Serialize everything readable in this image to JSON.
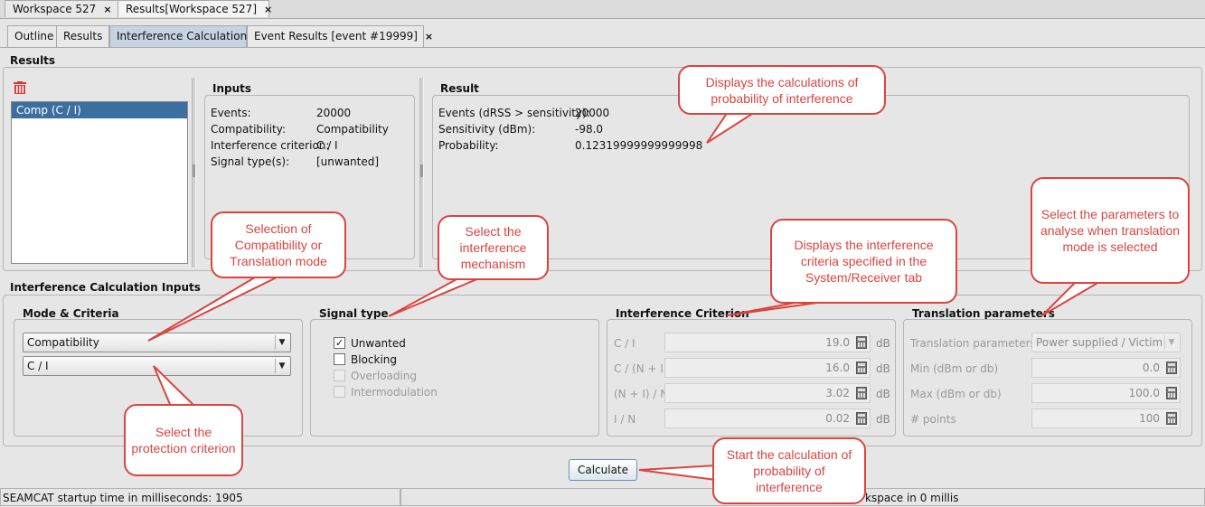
{
  "tabs_top": [
    {
      "label": "Workspace 527",
      "close": "×"
    },
    {
      "label": "Results[Workspace 527]",
      "close": "×"
    }
  ],
  "tabs_sub": [
    {
      "label": "Outline"
    },
    {
      "label": "Results"
    },
    {
      "label": "Interference Calculations"
    },
    {
      "label": "Event Results [event #19999]",
      "close": "×"
    }
  ],
  "results": {
    "section_title": "Results",
    "list_items": [
      "Comp (C / I)"
    ],
    "inputs": {
      "title": "Inputs",
      "rows": [
        {
          "label": "Events:",
          "value": "20000"
        },
        {
          "label": "Compatibility:",
          "value": "Compatibility"
        },
        {
          "label": "Interference criterion:",
          "value": "C / I"
        },
        {
          "label": "Signal type(s):",
          "value": "[unwanted]"
        }
      ]
    },
    "result": {
      "title": "Result",
      "rows": [
        {
          "label": "Events (dRSS > sensitivity):",
          "value": "20000"
        },
        {
          "label": "Sensitivity (dBm):",
          "value": "-98.0"
        },
        {
          "label": "Probability:",
          "value": "0.12319999999999998"
        }
      ]
    }
  },
  "calc_inputs": {
    "section_title": "Interference Calculation Inputs",
    "mode": {
      "title": "Mode & Criteria",
      "mode_value": "Compatibility",
      "criterion_value": "C / I",
      "arrow": "▼"
    },
    "signal": {
      "title": "Signal type",
      "items": [
        {
          "label": "Unwanted",
          "checked": true,
          "enabled": true,
          "mark": "✓"
        },
        {
          "label": "Blocking",
          "checked": false,
          "enabled": true
        },
        {
          "label": "Overloading",
          "checked": false,
          "enabled": false
        },
        {
          "label": "Intermodulation",
          "checked": false,
          "enabled": false
        }
      ]
    },
    "criterion": {
      "title": "Interference Criterion",
      "rows": [
        {
          "label": "C / I",
          "value": "19.0",
          "unit": "dB"
        },
        {
          "label": "C / (N + I)",
          "value": "16.0",
          "unit": "dB"
        },
        {
          "label": "(N + I) / N",
          "value": "3.02",
          "unit": "dB"
        },
        {
          "label": "I / N",
          "value": "0.02",
          "unit": "dB"
        }
      ]
    },
    "translation": {
      "title": "Translation parameters",
      "rows": [
        {
          "label": "Translation parameters",
          "value": "Power supplied / Victim"
        },
        {
          "label": "Min (dBm or db)",
          "value": "0.0"
        },
        {
          "label": "Max (dBm or db)",
          "value": "100.0"
        },
        {
          "label": "# points",
          "value": "100"
        }
      ]
    }
  },
  "calculate_label": "Calculate",
  "status": {
    "left": "SEAMCAT startup time in milliseconds: 1905",
    "right": "kspace in 0 millis"
  },
  "callouts": {
    "probability": "Displays the calculations of probability of interference",
    "mode": "Selection of Compatibility or Translation mode",
    "mechanism": "Select the interference mechanism",
    "criteria": "Displays the interference criteria specified in the System/Receiver tab",
    "translation": "Select the parameters to analyse when translation mode is selected",
    "protection": "Select the protection criterion",
    "start": "Start the calculation of probability of interference"
  },
  "colors": {
    "callout_red": "#d9453f",
    "selection_blue": "#3b6fa1",
    "active_tab": "#c5d3e2"
  }
}
